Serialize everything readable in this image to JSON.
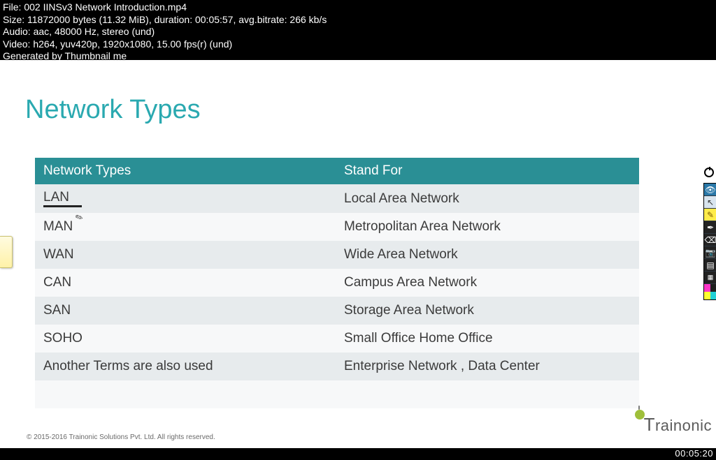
{
  "info": {
    "line1": "File: 002 IINSv3 Network Introduction.mp4",
    "line2": "Size: 11872000 bytes (11.32 MiB), duration: 00:05:57, avg.bitrate: 266 kb/s",
    "line3": "Audio: aac, 48000 Hz, stereo (und)",
    "line4": "Video: h264, yuv420p, 1920x1080, 15.00 fps(r) (und)",
    "line5": "Generated by Thumbnail me"
  },
  "slide": {
    "title": "Network Types",
    "headers": {
      "col1": "Network Types",
      "col2": "Stand For"
    },
    "rows": [
      {
        "type": "LAN",
        "stand": "Local Area Network"
      },
      {
        "type": "MAN",
        "stand": "Metropolitan Area Network"
      },
      {
        "type": "WAN",
        "stand": "Wide Area Network"
      },
      {
        "type": "CAN",
        "stand": "Campus Area Network"
      },
      {
        "type": "SAN",
        "stand": "Storage Area Network"
      },
      {
        "type": "SOHO",
        "stand": "Small Office Home Office"
      },
      {
        "type": "Another Terms are also used",
        "stand": "Enterprise Network , Data Center"
      }
    ],
    "footer": "© 2015-2016  Trainonic  Solutions Pvt. Ltd. All rights reserved.",
    "logo_text": "rainonic"
  },
  "toolbar": {
    "items": [
      "eye",
      "cursor",
      "highlighter",
      "pen",
      "eraser",
      "camera",
      "panel",
      "grid"
    ],
    "palette": [
      "#ff35c8",
      "#1e1e1e",
      "#ffff2e",
      "#21d0d6"
    ]
  },
  "timestamp": "00:05:20"
}
